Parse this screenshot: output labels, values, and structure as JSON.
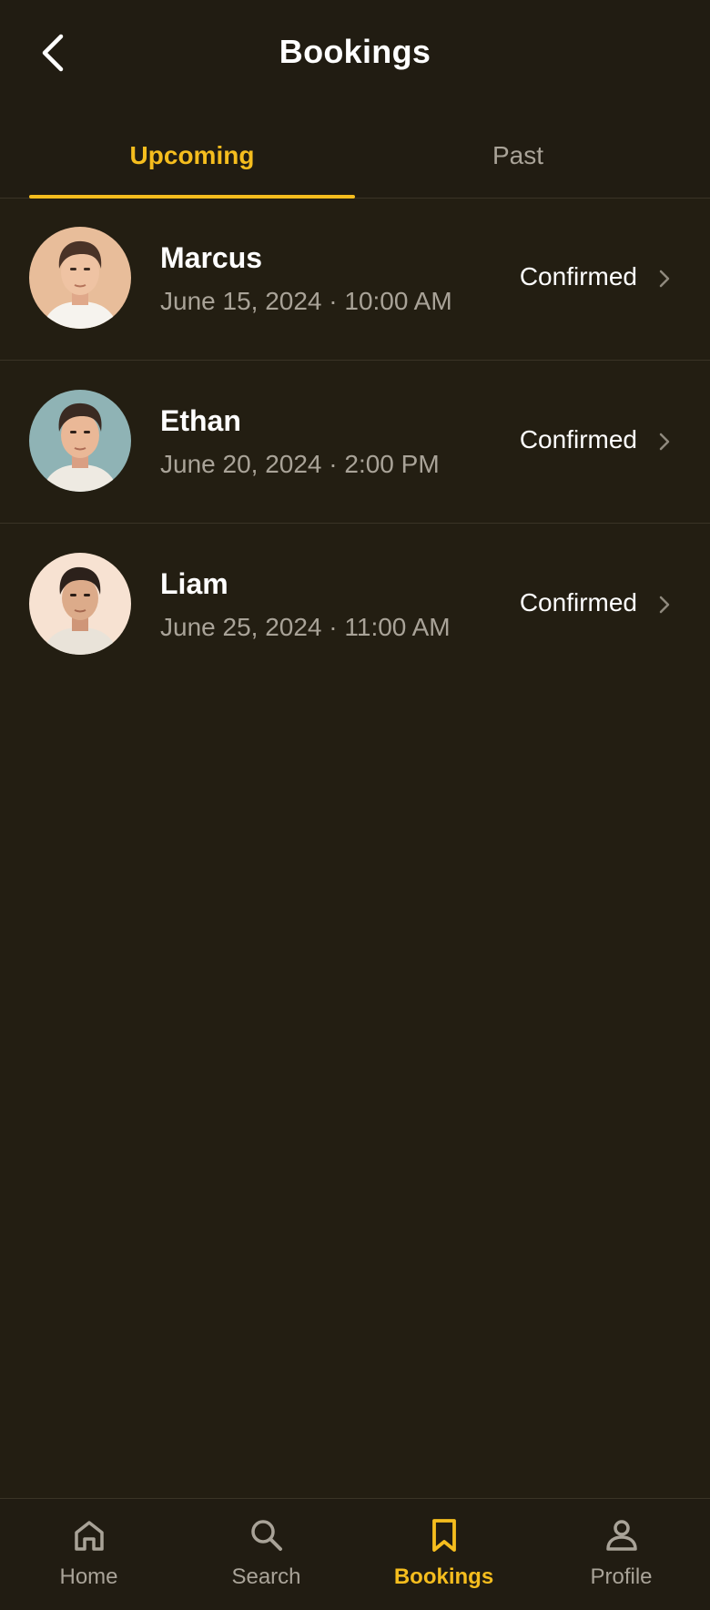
{
  "header": {
    "title": "Bookings",
    "back_icon": "chevron-left-icon"
  },
  "tabs": [
    {
      "label": "Upcoming",
      "active": true
    },
    {
      "label": "Past",
      "active": false
    }
  ],
  "bookings": [
    {
      "name": "Marcus",
      "datetime": "June 15, 2024 · 10:00 AM",
      "status": "Confirmed",
      "avatar": "avatar-marcus"
    },
    {
      "name": "Ethan",
      "datetime": "June 20, 2024 · 2:00 PM",
      "status": "Confirmed",
      "avatar": "avatar-ethan"
    },
    {
      "name": "Liam",
      "datetime": "June 25, 2024 · 11:00 AM",
      "status": "Confirmed",
      "avatar": "avatar-liam"
    }
  ],
  "nav": [
    {
      "label": "Home",
      "icon": "home-icon",
      "active": false
    },
    {
      "label": "Search",
      "icon": "search-icon",
      "active": false
    },
    {
      "label": "Bookings",
      "icon": "bookmark-icon",
      "active": true
    },
    {
      "label": "Profile",
      "icon": "profile-icon",
      "active": false
    }
  ],
  "colors": {
    "background": "#231e12",
    "accent": "#f5bd1e",
    "muted_text": "#a9a398",
    "divider": "#3a3426"
  }
}
